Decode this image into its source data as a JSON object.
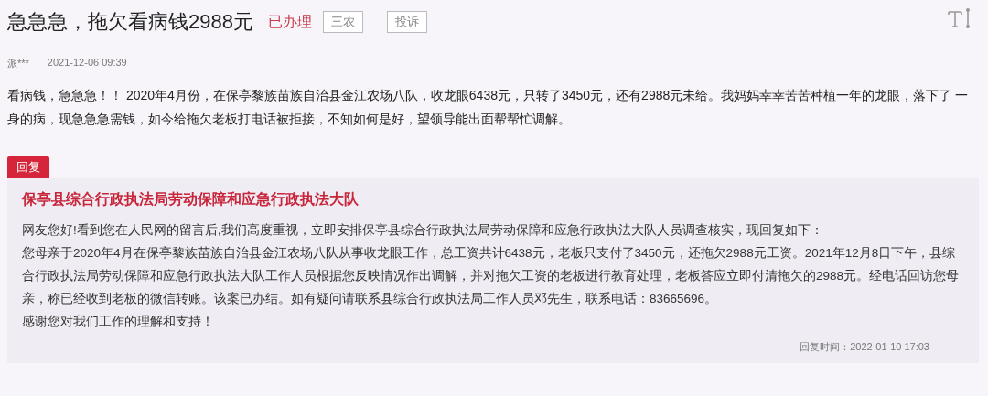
{
  "post": {
    "title": "急急急，拖欠看病钱2988元",
    "status": "已办理",
    "tags": [
      "三农",
      "投诉"
    ],
    "author": "派***",
    "time": "2021-12-06 09:39",
    "body": "看病钱，急急急！！ 2020年4月份，在保亭黎族苗族自治县金江农场八队，收龙眼6438元，只转了3450元，还有2988元未给。我妈妈幸幸苦苦种植一年的龙眼，落下了 一身的病，现急急急需钱，如今给拖欠老板打电话被拒接，不知如何是好，望领导能出面帮帮忙调解。"
  },
  "reply": {
    "label": "回复",
    "department": "保亭县综合行政执法局劳动保障和应急行政执法大队",
    "paragraphs": [
      "网友您好!看到您在人民网的留言后,我们高度重视，立即安排保亭县综合行政执法局劳动保障和应急行政执法大队人员调查核实，现回复如下：",
      "您母亲于2020年4月在保亭黎族苗族自治县金江农场八队从事收龙眼工作，总工资共计6438元，老板只支付了3450元，还拖欠2988元工资。2021年12月8日下午，县综合行政执法局劳动保障和应急行政执法大队工作人员根据您反映情况作出调解，并对拖欠工资的老板进行教育处理，老板答应立即付清拖欠的2988元。经电话回访您母亲，称已经收到老板的微信转账。该案已办结。如有疑问请联系县综合行政执法局工作人员邓先生，联系电话：83665696。",
      "感谢您对我们工作的理解和支持！"
    ],
    "time": "回复时间：2022-01-10 17:03"
  }
}
